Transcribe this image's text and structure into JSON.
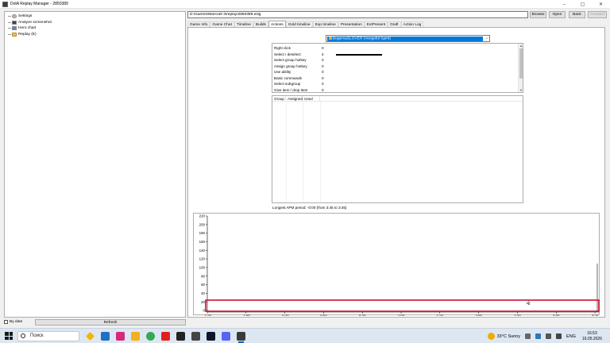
{
  "window": {
    "title": "DotA Replay Manager - 2850389"
  },
  "left_panel": {
    "tree": [
      {
        "label": "Settings",
        "icon": "gear-icon"
      },
      {
        "label": "Analyze screenshot",
        "icon": "camera-icon"
      },
      {
        "label": "Hero chart",
        "icon": "chart-icon"
      },
      {
        "label": "Replay (E)",
        "icon": "folder-icon"
      }
    ],
    "by_date_label": "By date",
    "refresh_label": "Refresh"
  },
  "toolbar": {
    "path_value": "D:\\Games\\Warcraft 3\\replay\\2850389.w3g",
    "browse_label": "Browse",
    "open_label": "Open",
    "back_label": "Back",
    "forward_label": "Forward"
  },
  "tabs": [
    "Game Info",
    "Game Chat",
    "Timeline",
    "Builds",
    "Actions",
    "Gold timeline",
    "Exp timeline",
    "Presentation",
    "ExtPresent",
    "Draft",
    "Action Log"
  ],
  "active_tab": "Actions",
  "player_select": {
    "selected": "BogemaSLOVER (Vengeful Spirit)"
  },
  "actions": [
    {
      "name": "Right click",
      "value": "0",
      "bar": 0
    },
    {
      "name": "Select / deselect",
      "value": "4",
      "bar": 1
    },
    {
      "name": "Select group hotkey",
      "value": "0",
      "bar": 0
    },
    {
      "name": "Assign group hotkey",
      "value": "0",
      "bar": 0
    },
    {
      "name": "Use ability",
      "value": "0",
      "bar": 0
    },
    {
      "name": "Basic commands",
      "value": "0",
      "bar": 0
    },
    {
      "name": "Select subgroup",
      "value": "0",
      "bar": 0
    },
    {
      "name": "Give item / drop item",
      "value": "0",
      "bar": 0
    }
  ],
  "groups_table": {
    "columns": [
      "Group",
      "Assigned",
      "Used"
    ]
  },
  "apm_text": "Longest APM period: -0:00 (from 3:45 to 3:45)",
  "chart_data": {
    "type": "line",
    "y_ticks": [
      "220",
      "200",
      "180",
      "160",
      "140",
      "120",
      "100",
      "80",
      "60",
      "40",
      "20",
      "0"
    ],
    "x_ticks": [
      "-1:20",
      "-1:00",
      "-0:20",
      "0:00",
      "0:20",
      "1:00",
      "1:20",
      "2:00",
      "2:20",
      "3:00",
      "3:20"
    ],
    "series": [],
    "selection_highlight": {
      "color": "#c8102e"
    }
  },
  "taskbar": {
    "search_placeholder": "Поиск",
    "weather": "33°C  Sunny",
    "language": "ENG",
    "time": "16:53",
    "date": "16.05.2026"
  },
  "colors": {
    "accent": "#0078d7",
    "highlight": "#c8102e"
  }
}
